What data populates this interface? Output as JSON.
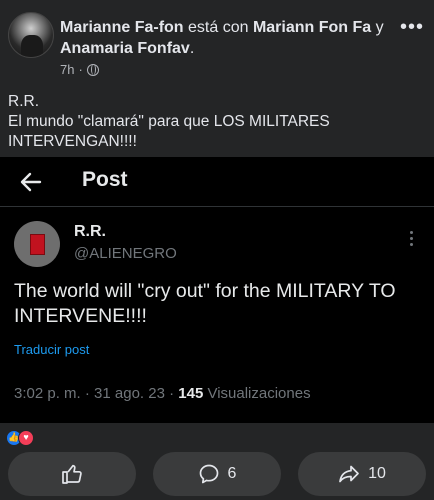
{
  "header": {
    "author": "Marianne Fa-fon",
    "with_text": "está con",
    "tagged_1": "Mariann Fon Fa",
    "and_text": "y",
    "tagged_2": "Anamaria Fonfav",
    "suffix": ".",
    "time": "7h",
    "separator": "·",
    "more": "•••"
  },
  "post": {
    "line1": "R.R.",
    "line2": "El mundo \"clamará\" para que LOS MILITARES INTERVENGAN!!!!"
  },
  "embed": {
    "title": "Post",
    "name": "R.R.",
    "handle": "@ALIENEGRO",
    "text": "The world will \"cry out\" for the MILITARY TO INTERVENE!!!!",
    "translate": "Traducir post",
    "date": "3:02 p. m. · 31 ago. 23 · ",
    "views_count": "145",
    "views_label": " Visualizaciones"
  },
  "actions": {
    "comments": "6",
    "shares": "10"
  },
  "icons": [
    "globe-icon",
    "back-arrow-icon",
    "like-icon",
    "comment-icon",
    "share-icon",
    "like-reaction-icon",
    "love-reaction-icon"
  ],
  "colors": {
    "background": "#242526",
    "embed_bg": "#000000",
    "link": "#1d9bf0",
    "button_bg": "#3a3b3c"
  }
}
